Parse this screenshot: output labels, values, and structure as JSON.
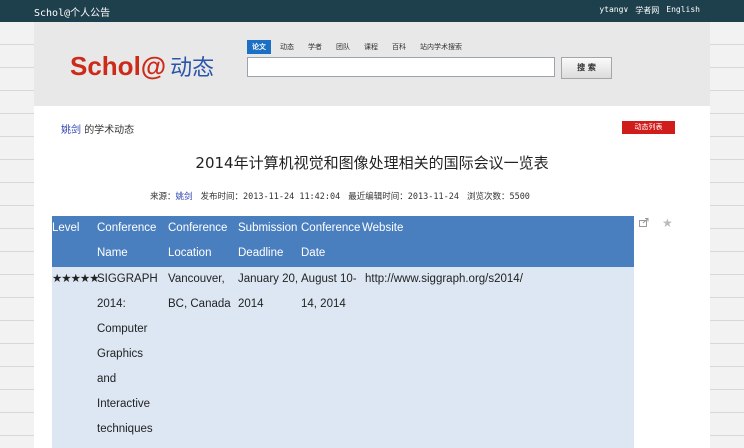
{
  "topbar": {
    "brand": "Schol@个人公告",
    "user": "ytang",
    "user_caret": "∨",
    "link_scholar": "学者网",
    "link_english": "English"
  },
  "header": {
    "logo_text": "Schol@",
    "logo_cn": "动态",
    "tabs": [
      {
        "label": "论文",
        "active": true
      },
      {
        "label": "动态",
        "active": false
      },
      {
        "label": "学者",
        "active": false
      },
      {
        "label": "团队",
        "active": false
      },
      {
        "label": "课程",
        "active": false
      },
      {
        "label": "百科",
        "active": false
      },
      {
        "label": "站内学术搜索",
        "active": false
      }
    ],
    "search_value": "",
    "search_button": "搜 索"
  },
  "subheader": {
    "author": "姚剑",
    "suffix": "的学术动态",
    "list_button": "动态列表"
  },
  "article": {
    "title": "2014年计算机视觉和图像处理相关的国际会议一览表",
    "source_label": "来源：",
    "source_value": "姚剑",
    "publish_time": "发布时间：2013-11-24 11:42:04",
    "edit_time": "最近编辑时间：2013-11-24",
    "views": "浏览次数：5500"
  },
  "icons": {
    "share": "share-icon",
    "star": "star-icon"
  },
  "table": {
    "headers": {
      "level": "Level",
      "conference_name": [
        "Conference",
        "Name"
      ],
      "location": [
        "Conference",
        "Location"
      ],
      "deadline": [
        "Submission",
        "Deadline"
      ],
      "date": [
        "Conference",
        "Date"
      ],
      "website": "Website"
    },
    "row": {
      "level": "★★★★★",
      "name": [
        "SIGGRAPH",
        "2014:",
        "Computer",
        "Graphics",
        "and",
        "Interactive",
        "techniques"
      ],
      "location": [
        "Vancouver,",
        "BC, Canada"
      ],
      "deadline": [
        "January 20,",
        "2014"
      ],
      "date": [
        "August 10-",
        "14, 2014"
      ],
      "website": "http://www.siggraph.org/s2014/"
    }
  },
  "colors": {
    "topbar": "#1e3f4c",
    "table_header": "#4a7fbf",
    "table_body": "#dce7f3",
    "accent_red": "#d11c1c",
    "link_blue": "#2a3fb0"
  }
}
